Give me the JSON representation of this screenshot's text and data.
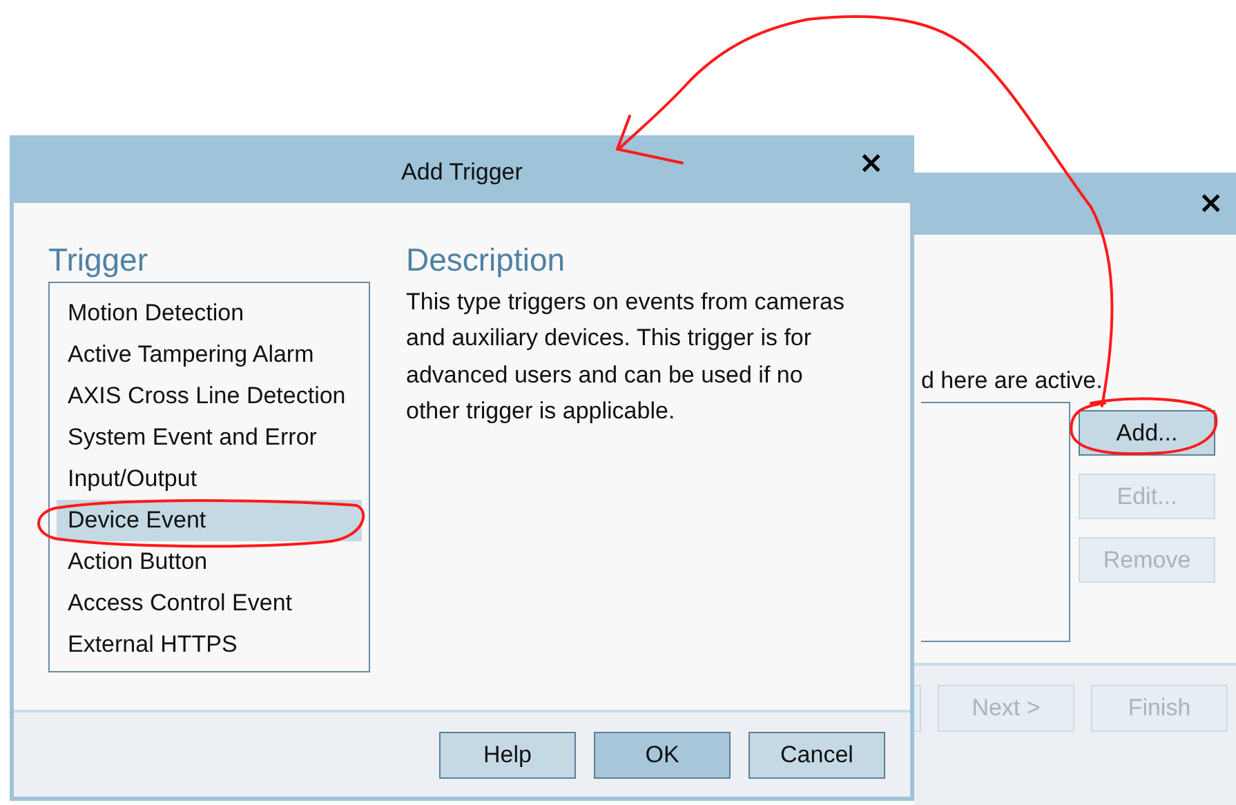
{
  "background_window": {
    "close": "×",
    "text": "d here are active.",
    "side_buttons": [
      {
        "label": "Add...",
        "disabled": false
      },
      {
        "label": "Edit...",
        "disabled": true
      },
      {
        "label": "Remove",
        "disabled": true
      }
    ],
    "footer_buttons": [
      {
        "label": "Next >",
        "disabled": true
      },
      {
        "label": "Finish",
        "disabled": true
      }
    ]
  },
  "dialog": {
    "title": "Add Trigger",
    "close": "×",
    "trigger_heading": "Trigger",
    "triggers": [
      {
        "label": "Motion Detection",
        "selected": false
      },
      {
        "label": "Active Tampering Alarm",
        "selected": false
      },
      {
        "label": "AXIS Cross Line Detection",
        "selected": false
      },
      {
        "label": "System Event and Error",
        "selected": false
      },
      {
        "label": "Input/Output",
        "selected": false
      },
      {
        "label": "Device Event",
        "selected": true
      },
      {
        "label": "Action Button",
        "selected": false
      },
      {
        "label": "Access Control Event",
        "selected": false
      },
      {
        "label": "External HTTPS",
        "selected": false
      }
    ],
    "description_heading": "Description",
    "description": "This type triggers on events from cameras and auxiliary devices. This trigger is for advanced users and can be used if no other trigger is applicable.",
    "buttons": [
      {
        "label": "Help",
        "default": false
      },
      {
        "label": "OK",
        "default": true
      },
      {
        "label": "Cancel",
        "default": false
      }
    ]
  }
}
